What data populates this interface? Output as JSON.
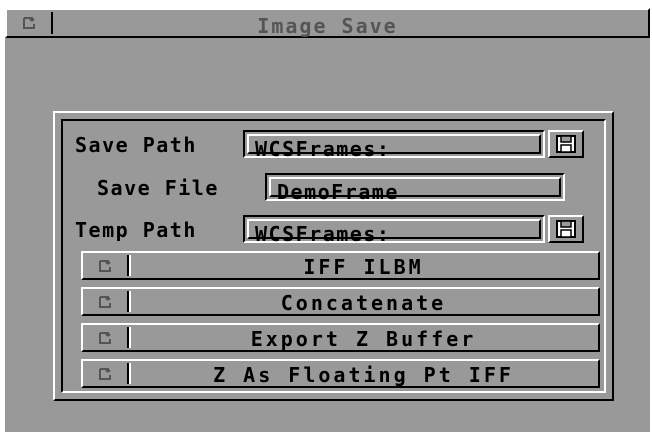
{
  "window": {
    "title": "Image Save"
  },
  "form": {
    "save_path": {
      "label": "Save Path",
      "value": "WCSFrames:"
    },
    "save_file": {
      "label": "Save File",
      "value": "DemoFrame"
    },
    "temp_path": {
      "label": "Temp Path",
      "value": "WCSFrames:"
    }
  },
  "cycles": [
    {
      "label": "IFF ILBM"
    },
    {
      "label": "Concatenate"
    },
    {
      "label": "Export Z Buffer"
    },
    {
      "label": "Z As Floating Pt IFF"
    }
  ],
  "icons": {
    "title_gadget": "cycle-icon",
    "save_path_button": "disk-icon",
    "temp_path_button": "disk-icon",
    "cycle_gadget": "cycle-icon"
  },
  "colors": {
    "window_bg": "#999999",
    "highlight": "#ffffff",
    "shadow": "#000000",
    "title_text": "#555555"
  }
}
